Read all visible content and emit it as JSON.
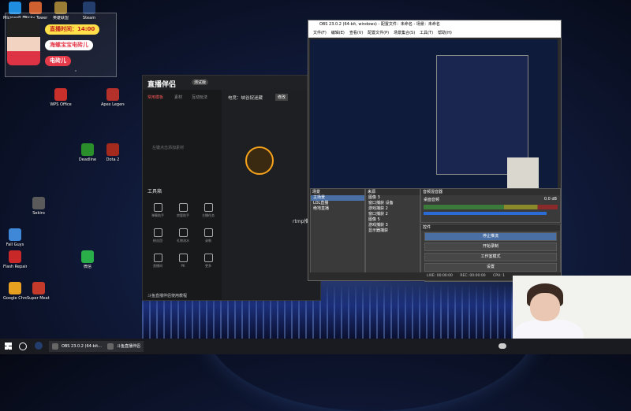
{
  "desktop": {
    "icons": [
      {
        "label": "Microsoft Edge",
        "color": "#1f8de0"
      },
      {
        "label": "Tricky Towers",
        "color": "#d06030"
      },
      {
        "label": "英雄联盟",
        "color": "#9b7d35"
      },
      {
        "label": "Steam",
        "color": "#233d6c"
      },
      {
        "label": "WPS Office",
        "color": "#c9302c"
      },
      {
        "label": "Apex Legends",
        "color": "#b3312a"
      },
      {
        "label": "Dota 2",
        "color": "#a52a1e"
      },
      {
        "label": "Deadline",
        "color": "#2a8f2a"
      },
      {
        "label": "Sekiro",
        "color": "#5a5a5a"
      },
      {
        "label": "Fall Guys",
        "color": "#3f88d8"
      },
      {
        "label": "Flash Repair",
        "color": "#c82828"
      },
      {
        "label": "Google Chrome",
        "color": "#e8a020"
      },
      {
        "label": "Super Meat Boy",
        "color": "#c33a2a"
      },
      {
        "label": "微信",
        "color": "#2aae4a"
      }
    ]
  },
  "widget": {
    "time_pill": "直播时间：14:00",
    "name_pill_1": "海螺宝宝电砖儿",
    "name_pill_2": "电砖儿"
  },
  "stream_app": {
    "brand": "直播伴侣",
    "version": "测试版",
    "tabs": [
      "常用模板",
      "素材",
      "互动玩法"
    ],
    "status_title": "电竞：峡谷捉迷藏",
    "status_btn": "修改",
    "live_label": "rtmp推流",
    "hint": "左键点击添加素材",
    "tools_title": "工具箱",
    "tools": [
      "弹幕助手",
      "房管助手",
      "主播任务",
      "粉丝团",
      "礼物流水",
      "录制",
      "直播间",
      "PK",
      "更多"
    ],
    "bottom_note": "斗鱼直播伴侣使用教程"
  },
  "obs": {
    "title": "OBS 23.0.2 (64-bit, windows) - 配置文件：未命名 - 场景：未命名",
    "menu": [
      "文件(F)",
      "编辑(E)",
      "查看(V)",
      "配置文件(P)",
      "场景集合(S)",
      "工具(T)",
      "帮助(H)"
    ],
    "scenes_header": "场景",
    "scenes": [
      "主场景",
      "LOL直播",
      "绝地直播"
    ],
    "sources_header": "来源",
    "sources": [
      "图像 3",
      "窗口捕获 设备",
      "游戏捕获 2",
      "窗口捕获 2",
      "图像 5",
      "游戏捕获 3",
      "显示器捕获"
    ],
    "mixer_header": "音频混音器",
    "mixer_track": "桌面音频",
    "mixer_value": "0.0 dB",
    "controls_header": "控件",
    "controls": [
      "停止推流",
      "开始录制",
      "工作室模式",
      "设置",
      "退出"
    ],
    "status": {
      "live": "LIVE: 00:00:00",
      "rec": "REC: 00:00:00",
      "cpu": "CPU: 1"
    }
  },
  "taskbar": {
    "items": [
      "OBS 23.0.2 (64-bit...",
      "斗鱼直播伴侣"
    ]
  }
}
